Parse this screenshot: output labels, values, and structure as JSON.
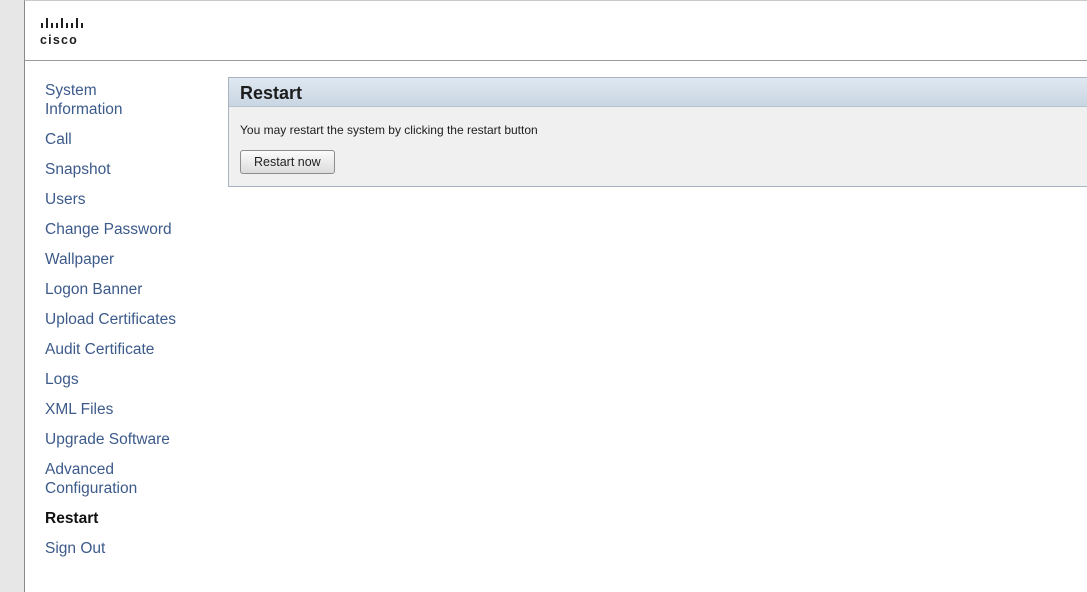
{
  "brand": {
    "logo_text": "cisco"
  },
  "sidebar": {
    "items": [
      {
        "label": "System Information"
      },
      {
        "label": "Call"
      },
      {
        "label": "Snapshot"
      },
      {
        "label": "Users"
      },
      {
        "label": "Change Password"
      },
      {
        "label": "Wallpaper"
      },
      {
        "label": "Logon Banner"
      },
      {
        "label": "Upload Certificates"
      },
      {
        "label": "Audit Certificate"
      },
      {
        "label": "Logs"
      },
      {
        "label": "XML Files"
      },
      {
        "label": "Upgrade Software"
      },
      {
        "label": "Advanced Configuration"
      },
      {
        "label": "Restart"
      },
      {
        "label": "Sign Out"
      }
    ],
    "active": "Restart"
  },
  "panel": {
    "title": "Restart",
    "message": "You may restart the system by clicking the restart button",
    "button_label": "Restart now"
  },
  "colors": {
    "link": "#3c5a8a",
    "active": "#111111",
    "panel_header": "#c9d6e3"
  }
}
